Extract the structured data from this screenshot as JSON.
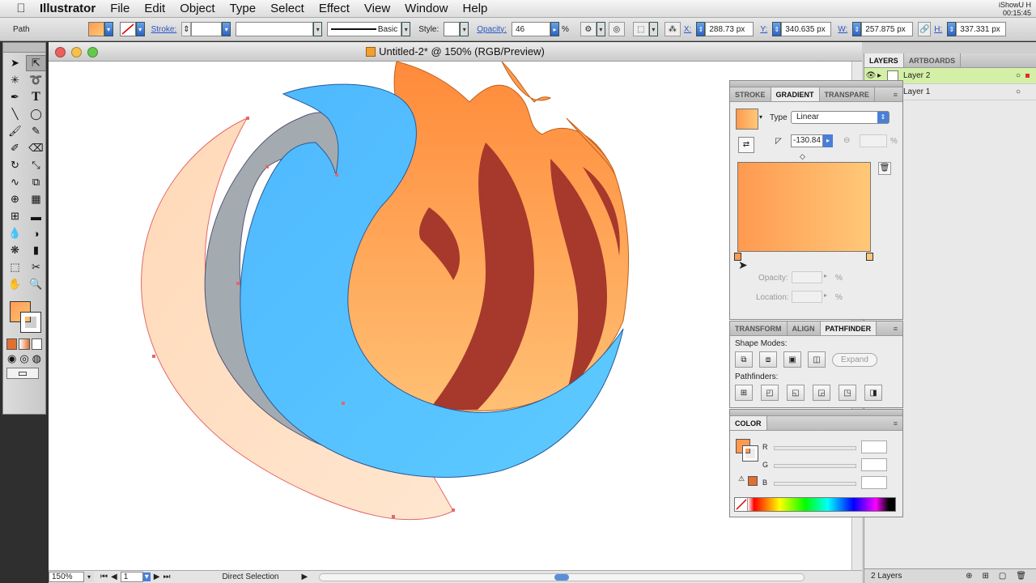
{
  "menubar": {
    "app": "Illustrator",
    "items": [
      "File",
      "Edit",
      "Object",
      "Type",
      "Select",
      "Effect",
      "View",
      "Window",
      "Help"
    ],
    "clock_line1": "iShowU H",
    "clock_line2": "00:15:45"
  },
  "control": {
    "selection_type": "Path",
    "stroke_label": "Stroke:",
    "brush_label": "Basic",
    "style_label": "Style:",
    "opacity_label": "Opacity:",
    "opacity_value": "46",
    "percent": "%",
    "x_label": "X:",
    "x_value": "288.73 px",
    "y_label": "Y:",
    "y_value": "340.635 px",
    "w_label": "W:",
    "w_value": "257.875 px",
    "h_label": "H:",
    "h_value": "337.331 px"
  },
  "document": {
    "title": "Untitled-2* @ 150% (RGB/Preview)",
    "zoom": "150%",
    "page": "1",
    "status_tool": "Direct Selection"
  },
  "layers": {
    "tabs": [
      "LAYERS",
      "ARTBOARDS"
    ],
    "items": [
      {
        "name": "Layer 2",
        "active": true
      },
      {
        "name": "Layer 1",
        "active": false
      }
    ],
    "count": "2 Layers"
  },
  "gradient_panel": {
    "tabs": [
      "STROKE",
      "GRADIENT",
      "TRANSPARE"
    ],
    "type_label": "Type",
    "type_value": "Linear",
    "angle_value": "-130.84",
    "percent": "%",
    "opacity_label": "Opacity:",
    "location_label": "Location:",
    "colors": {
      "start": "#ff9a50",
      "end": "#ffc878"
    }
  },
  "pathfinder_panel": {
    "tabs": [
      "TRANSFORM",
      "ALIGN",
      "PATHFINDER"
    ],
    "shape_modes_label": "Shape Modes:",
    "expand_label": "Expand",
    "pathfinders_label": "Pathfinders:"
  },
  "color_panel": {
    "title": "COLOR",
    "channels": [
      "R",
      "G",
      "B"
    ]
  },
  "tools": [
    "selection-tool",
    "direct-selection-tool",
    "magic-wand-tool",
    "lasso-tool",
    "pen-tool",
    "type-tool",
    "line-tool",
    "ellipse-tool",
    "paintbrush-tool",
    "pencil-tool",
    "blob-brush-tool",
    "eraser-tool",
    "rotate-tool",
    "scale-tool",
    "warp-tool",
    "free-transform-tool",
    "shape-builder-tool",
    "perspective-grid-tool",
    "mesh-tool",
    "gradient-tool",
    "eyedropper-tool",
    "blend-tool",
    "symbol-sprayer-tool",
    "graph-tool",
    "artboard-tool",
    "slice-tool",
    "hand-tool",
    "zoom-tool"
  ]
}
